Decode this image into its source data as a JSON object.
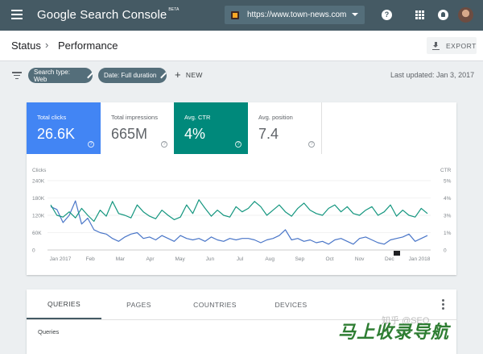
{
  "header": {
    "app_title": "Google Search Console",
    "beta_tag": "BETA",
    "property_url": "https://www.town-news.com"
  },
  "icons": [
    "menu-icon",
    "property-icon",
    "chevron-down-icon",
    "help-icon",
    "apps-icon",
    "notifications-icon",
    "avatar",
    "chevron-right-icon",
    "download-icon",
    "filter-icon",
    "pencil-icon",
    "plus-icon",
    "more-vert-icon"
  ],
  "breadcrumb": {
    "parent": "Status",
    "current": "Performance"
  },
  "toolbar": {
    "export_label": "EXPORT"
  },
  "filters": {
    "chips": [
      {
        "label": "Search type: Web"
      },
      {
        "label": "Date: Full duration"
      }
    ],
    "new_label": "NEW",
    "last_updated": "Last updated: Jan 3, 2017"
  },
  "metrics": [
    {
      "label": "Total clicks",
      "value": "26.6K",
      "selected": true,
      "color": "#4285f4"
    },
    {
      "label": "Total impressions",
      "value": "665M",
      "selected": false
    },
    {
      "label": "Avg. CTR",
      "value": "4%",
      "selected": true,
      "color": "#00897b"
    },
    {
      "label": "Avg. position",
      "value": "7.4",
      "selected": false
    }
  ],
  "chart_data": {
    "type": "line",
    "left_axis_label": "Clicks",
    "right_axis_label": "CTR",
    "left_ticks": [
      "240K",
      "180K",
      "120K",
      "60K",
      "0"
    ],
    "right_ticks": [
      "5%",
      "4%",
      "3%",
      "1%",
      "0"
    ],
    "left_ylim": [
      0,
      240000
    ],
    "right_ylim": [
      0,
      5
    ],
    "x_ticks": [
      "Jan 2017",
      "Feb",
      "Mar",
      "Apr",
      "May",
      "Jun",
      "Jul",
      "Aug",
      "Sep",
      "Oct",
      "Nov",
      "Dec",
      "Jan 2018"
    ],
    "series": [
      {
        "name": "Clicks",
        "color": "#4a76c8",
        "values": [
          150000,
          140000,
          95000,
          120000,
          170000,
          90000,
          110000,
          70000,
          60000,
          55000,
          40000,
          30000,
          45000,
          55000,
          60000,
          40000,
          45000,
          35000,
          50000,
          40000,
          30000,
          50000,
          40000,
          35000,
          40000,
          30000,
          45000,
          35000,
          30000,
          40000,
          35000,
          40000,
          40000,
          35000,
          25000,
          35000,
          40000,
          50000,
          70000,
          35000,
          40000,
          30000,
          35000,
          25000,
          30000,
          20000,
          35000,
          40000,
          30000,
          20000,
          40000,
          45000,
          35000,
          25000,
          20000,
          35000,
          40000,
          45000,
          55000,
          30000,
          40000,
          50000
        ]
      },
      {
        "name": "CTR",
        "color": "#14967f",
        "values": [
          3.6,
          3.0,
          2.8,
          3.2,
          2.7,
          3.4,
          3.0,
          2.3,
          3.3,
          2.9,
          3.8,
          3.1,
          3.0,
          2.7,
          3.6,
          3.2,
          2.9,
          2.6,
          3.3,
          3.0,
          2.5,
          2.8,
          3.6,
          3.1,
          3.9,
          3.4,
          2.9,
          3.3,
          3.0,
          2.8,
          3.5,
          3.2,
          3.4,
          3.8,
          3.5,
          3.0,
          3.3,
          3.6,
          3.2,
          2.9,
          3.4,
          3.7,
          3.3,
          3.1,
          3.0,
          3.4,
          3.6,
          3.2,
          3.5,
          3.1,
          3.0,
          3.3,
          3.5,
          3.0,
          3.2,
          3.6,
          2.9,
          3.3,
          3.0,
          2.8,
          3.4,
          3.1
        ]
      }
    ],
    "grid": true
  },
  "tabs": [
    {
      "label": "QUERIES",
      "active": true
    },
    {
      "label": "PAGES",
      "active": false
    },
    {
      "label": "COUNTRIES",
      "active": false
    },
    {
      "label": "DEVICES",
      "active": false
    }
  ],
  "table": {
    "column_header": "Queries"
  },
  "watermark": {
    "main": "马上收录导航",
    "sub": "知乎 @SEO"
  }
}
